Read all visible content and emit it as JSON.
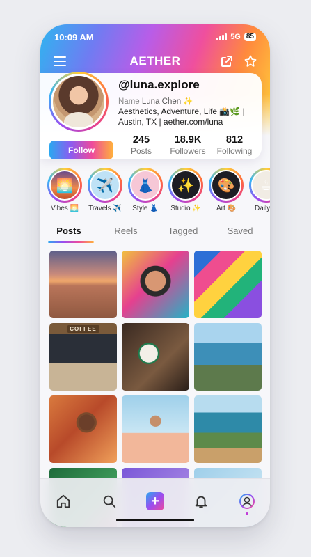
{
  "status": {
    "time": "10:09 AM",
    "network": "5G",
    "battery": "85"
  },
  "nav": {
    "brand": "AETHER"
  },
  "profile": {
    "handle": "@luna.explore",
    "name_label": "Name",
    "name": "Luna Chen ✨",
    "bio_line1": "Aesthetics, Adventure, Life 📸🌿 |",
    "bio_line2_prefix": "Austin, TX | ",
    "bio_link": "aether.com/luna",
    "follow_label": "Follow",
    "stats": [
      {
        "value": "245",
        "label": "Posts"
      },
      {
        "value": "18.9K",
        "label": "Followers"
      },
      {
        "value": "812",
        "label": "Following"
      }
    ]
  },
  "highlights": [
    {
      "label": "Vibes 🌅",
      "emoji": "🌅"
    },
    {
      "label": "Travels ✈️",
      "emoji": "✈️"
    },
    {
      "label": "Style 👗",
      "emoji": "👗"
    },
    {
      "label": "Studio ✨",
      "emoji": "✨"
    },
    {
      "label": "Art 🎨",
      "emoji": "🎨"
    },
    {
      "label": "Daily ☕",
      "emoji": "☕"
    }
  ],
  "tabs": [
    {
      "label": "Posts",
      "active": true
    },
    {
      "label": "Reels",
      "active": false
    },
    {
      "label": "Tagged",
      "active": false
    },
    {
      "label": "Saved",
      "active": false
    }
  ],
  "grid": {
    "coffee_sign": "COFFEE"
  },
  "colors": {
    "gradient": [
      "#2fb4f0",
      "#6f7cf2",
      "#b85de8",
      "#ef4f9e",
      "#ff8a3d",
      "#ffd43a"
    ],
    "active_dot": "#c13dd8"
  },
  "bottom_nav": [
    {
      "icon": "home-icon"
    },
    {
      "icon": "search-icon"
    },
    {
      "icon": "add-post-icon"
    },
    {
      "icon": "bell-icon"
    },
    {
      "icon": "profile-icon",
      "active": true
    }
  ]
}
